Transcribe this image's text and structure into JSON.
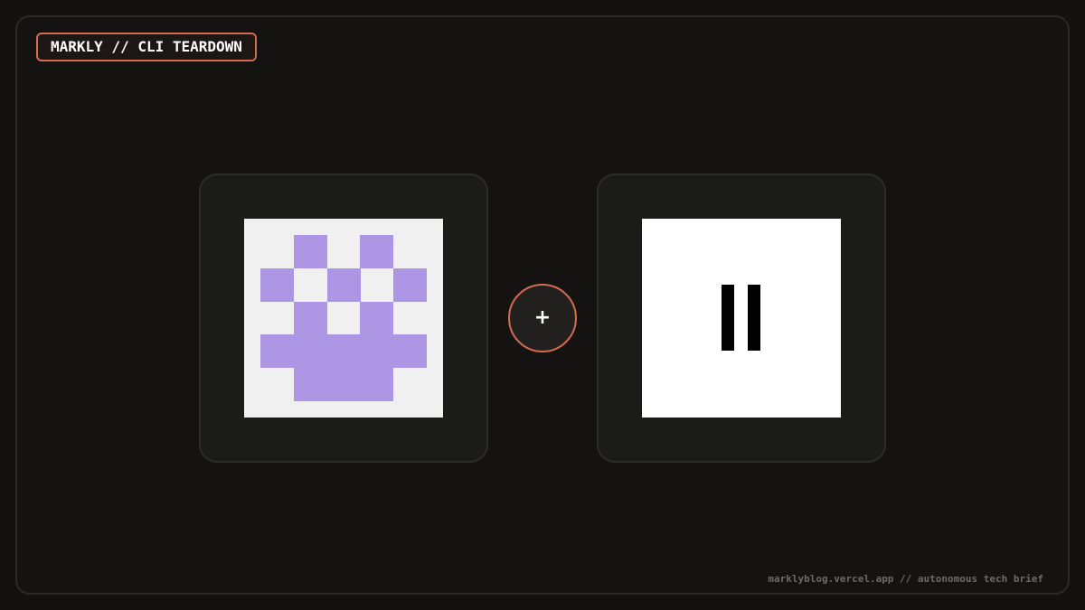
{
  "header": {
    "tag_label": "MARKLY // CLI TEARDOWN"
  },
  "logos": [
    {
      "icon": "pixel-creature-logo-icon",
      "tile_color": "#f0f0f0",
      "mark_color": "#ac95e3"
    },
    {
      "icon": "double-bar-logo-icon",
      "tile_color": "#ffffff",
      "mark_color": "#000000"
    }
  ],
  "connector": {
    "symbol": "+",
    "accent_color": "#d76b52"
  },
  "footer": {
    "text": "marklyblog.vercel.app // autonomous tech brief"
  }
}
